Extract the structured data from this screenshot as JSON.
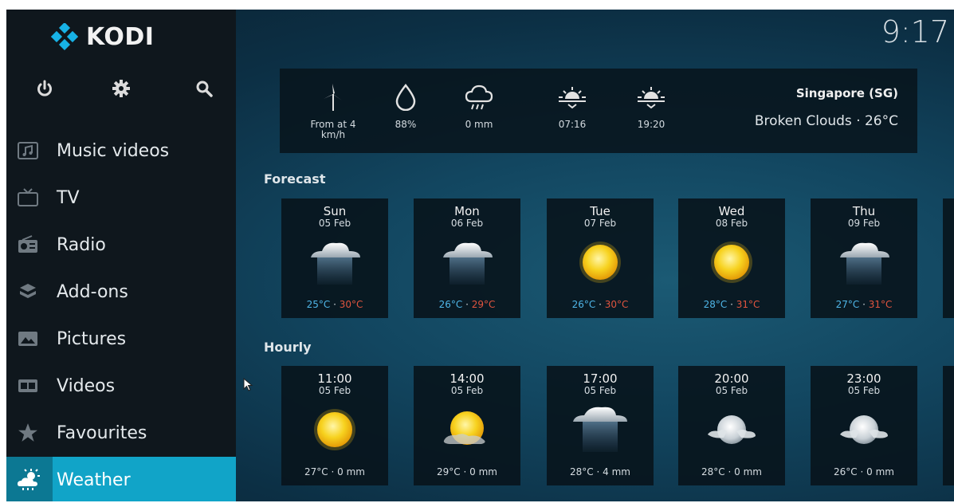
{
  "app": {
    "name": "KODI"
  },
  "clock": "9:17",
  "topbar": {
    "icons": [
      "power-icon",
      "gear-icon",
      "search-icon"
    ]
  },
  "menu": [
    {
      "label": "Music videos",
      "icon": "music-video-icon"
    },
    {
      "label": "TV",
      "icon": "tv-icon"
    },
    {
      "label": "Radio",
      "icon": "radio-icon"
    },
    {
      "label": "Add-ons",
      "icon": "addons-icon"
    },
    {
      "label": "Pictures",
      "icon": "pictures-icon"
    },
    {
      "label": "Videos",
      "icon": "videos-icon"
    },
    {
      "label": "Favourites",
      "icon": "star-icon"
    },
    {
      "label": "Weather",
      "icon": "weather-icon",
      "active": true
    }
  ],
  "current": {
    "wind": "From  at 4 km/h",
    "humidity": "88%",
    "precipitation": "0 mm",
    "sunrise": "07:16",
    "sunset": "19:20",
    "location": "Singapore (SG)",
    "condition": "Broken Clouds · 26°C"
  },
  "forecast": {
    "label": "Forecast",
    "days": [
      {
        "day": "Sun",
        "date": "05 Feb",
        "low": "25°C",
        "high": "30°C",
        "icon": "rain-cloud-icon"
      },
      {
        "day": "Mon",
        "date": "06 Feb",
        "low": "26°C",
        "high": "29°C",
        "icon": "rain-cloud-icon"
      },
      {
        "day": "Tue",
        "date": "07 Feb",
        "low": "26°C",
        "high": "30°C",
        "icon": "sun-icon"
      },
      {
        "day": "Wed",
        "date": "08 Feb",
        "low": "28°C",
        "high": "31°C",
        "icon": "sun-icon"
      },
      {
        "day": "Thu",
        "date": "09 Feb",
        "low": "27°C",
        "high": "31°C",
        "icon": "rain-cloud-icon"
      }
    ],
    "separator": " · "
  },
  "hourly": {
    "label": "Hourly",
    "hours": [
      {
        "time": "11:00",
        "date": "05 Feb",
        "summary": "27°C · 0 mm",
        "icon": "sun-icon"
      },
      {
        "time": "14:00",
        "date": "05 Feb",
        "summary": "29°C · 0 mm",
        "icon": "sun-cloud-icon"
      },
      {
        "time": "17:00",
        "date": "05 Feb",
        "summary": "28°C · 4 mm",
        "icon": "rain-cloud-icon"
      },
      {
        "time": "20:00",
        "date": "05 Feb",
        "summary": "28°C · 0 mm",
        "icon": "moon-cloud-icon"
      },
      {
        "time": "23:00",
        "date": "05 Feb",
        "summary": "26°C · 0 mm",
        "icon": "moon-cloud-icon"
      }
    ]
  },
  "colors": {
    "accent": "#11a4c8",
    "low": "#4fb6e8",
    "high": "#e0543f",
    "sun": "#f2c81c"
  }
}
